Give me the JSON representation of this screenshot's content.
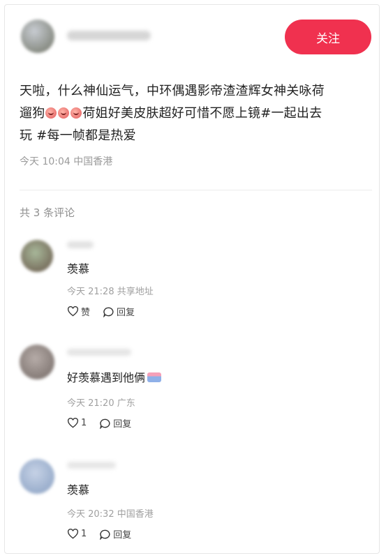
{
  "post": {
    "follow_label": "关注",
    "text_line1": "天啦，什么神仙运气，中环偶遇影帝渣渣辉女神关咏荷",
    "text_line2_pre": "遛狗",
    "text_line2_post": "荷姐好美皮肤超好可惜不愿上镜#一起出去",
    "text_line3": "玩 #每一帧都是热爱",
    "meta": "今天 10:04 中国香港"
  },
  "comments_header": "共 3 条评论",
  "comments": [
    {
      "text": "羡慕",
      "meta": "今天 21:28 共享地址",
      "like_label": "赞",
      "reply_label": "回复"
    },
    {
      "text": "好羡慕遇到他俩",
      "meta": "今天 21:20 广东",
      "like_label": "1",
      "reply_label": "回复"
    },
    {
      "text": "羡慕",
      "meta": "今天 20:32 中国香港",
      "like_label": "1",
      "reply_label": "回复"
    }
  ],
  "colors": {
    "follow_button": "#f0314f",
    "meta_text": "#9a9a9a"
  }
}
